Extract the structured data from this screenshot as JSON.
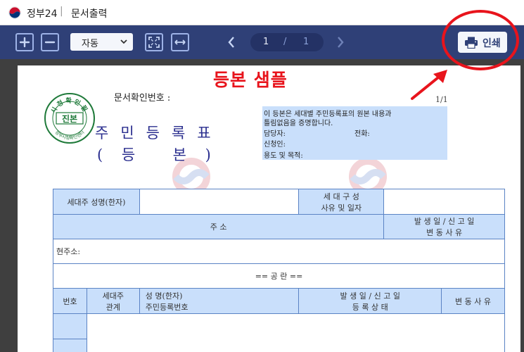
{
  "window": {
    "app_name": "정부24",
    "separator": "|",
    "title": "문서출력"
  },
  "toolbar": {
    "zoom_in_icon": "plus-square-icon",
    "zoom_out_icon": "minus-square-icon",
    "zoom_value": "자동",
    "fit_page_icon": "fit-page-icon",
    "fit_width_icon": "fit-width-icon",
    "current_page": "1",
    "page_separator": "/",
    "total_pages": "1",
    "print_label": "인쇄",
    "accent": "#2f4077"
  },
  "annotation": {
    "text": "등본 샘플",
    "color": "#e8141c"
  },
  "document": {
    "doc_no_label": "문서확인번호 :",
    "page_count": "1/1",
    "stamp": {
      "top_text": "시청확인필",
      "center_text": "진본",
      "bottom_text": "정부시청확인센터"
    },
    "title": "주민등록표",
    "subtitle": "(    등        본    )",
    "notice": {
      "line1": "이 등본은 세대별 주민등록표의 원본 내용과",
      "line2": "틀림없음을 증명합니다.",
      "manager_label": "담당자:",
      "phone_label": "전화:",
      "applicant_label": "신청인:",
      "purpose_label": "용도 및 목적:"
    },
    "table": {
      "householder_name_label": "세대주 성명(한자)",
      "composition_label_1": "세 대 구 성",
      "composition_label_2": "사유 및 일자",
      "address_label": "주              소",
      "occur_report_1": "발  생  일   /   신  고  일",
      "occur_report_2": "변        동        사        유",
      "current_address_label": "현주소:",
      "blank_label": "==     공      란     ==",
      "col_no": "번호",
      "col_relation_1": "세대주",
      "col_relation_2": "관계",
      "col_name_1": "성   명(한자)",
      "col_name_2": "주민등록번호",
      "col_dates_1": "발  생  일   /   신  고  일",
      "col_dates_2": "등  록  상  태",
      "col_reason": "변 동 사 유"
    }
  }
}
